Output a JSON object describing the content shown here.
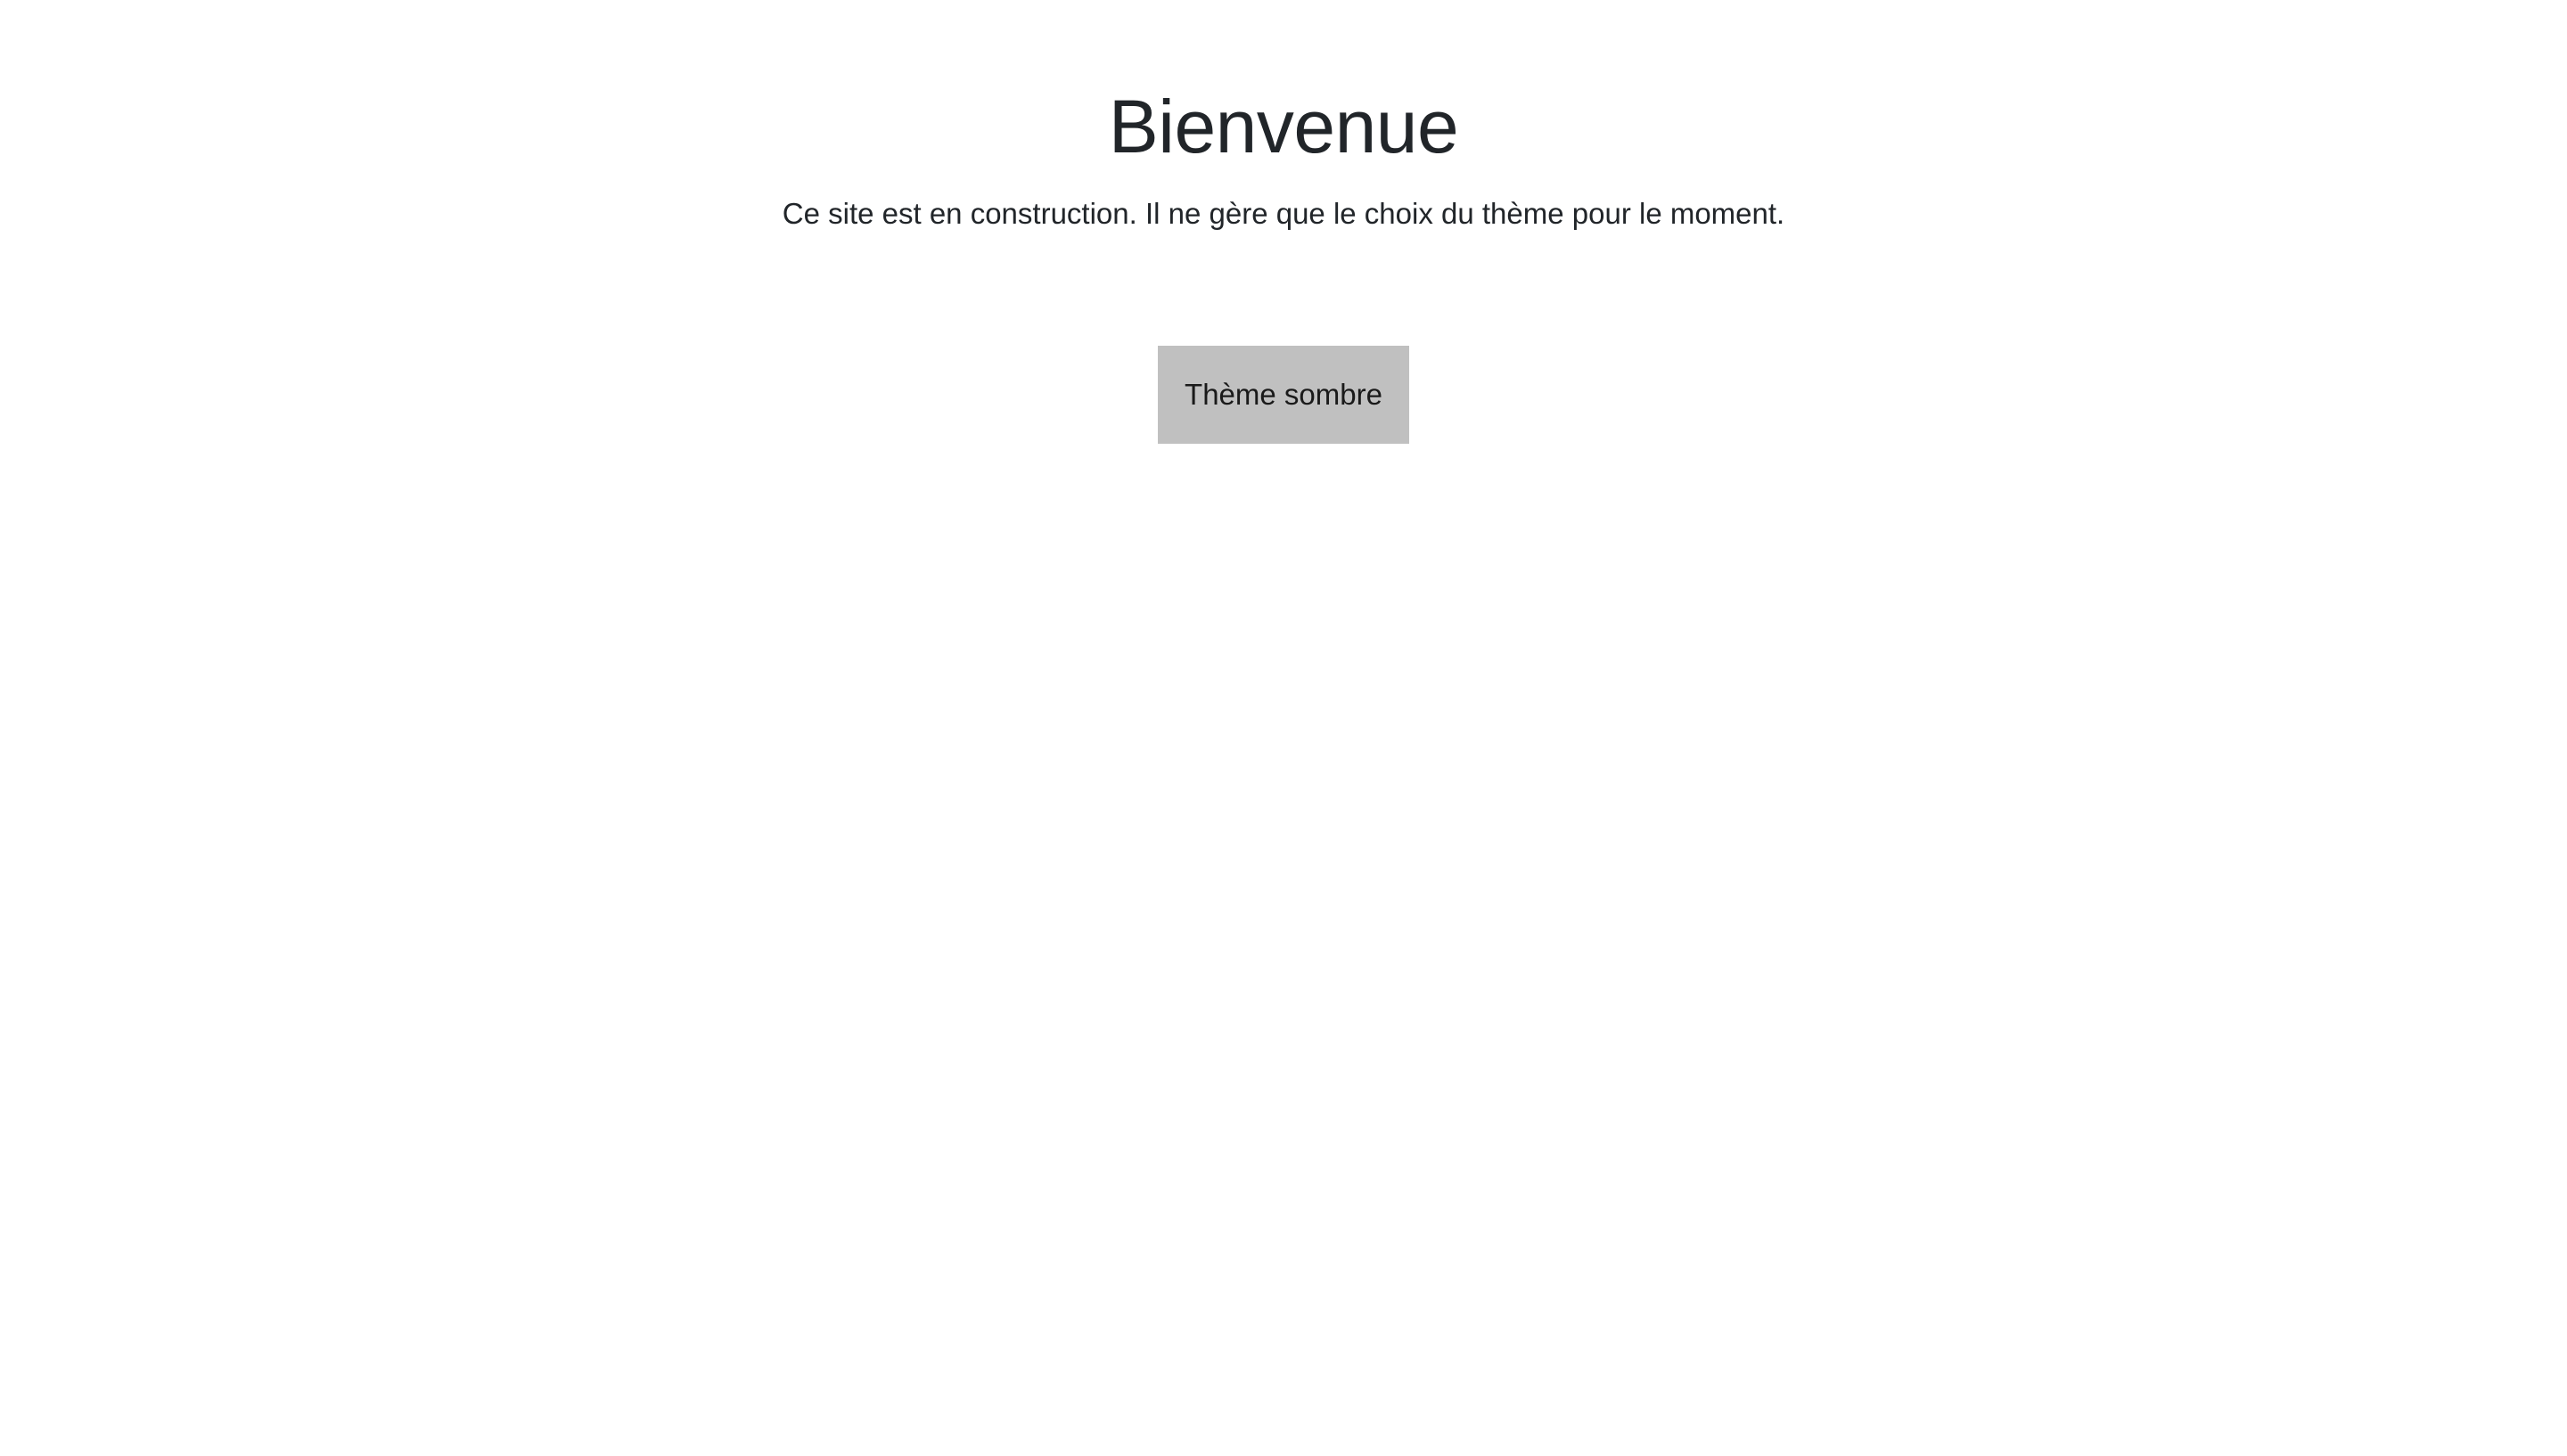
{
  "main": {
    "title": "Bienvenue",
    "subtitle": "Ce site est en construction. Il ne gère que le choix du thème pour le moment.",
    "theme_button_label": "Thème sombre"
  },
  "colors": {
    "background": "#ffffff",
    "text": "#212529",
    "button_background": "#c0c0c0"
  }
}
